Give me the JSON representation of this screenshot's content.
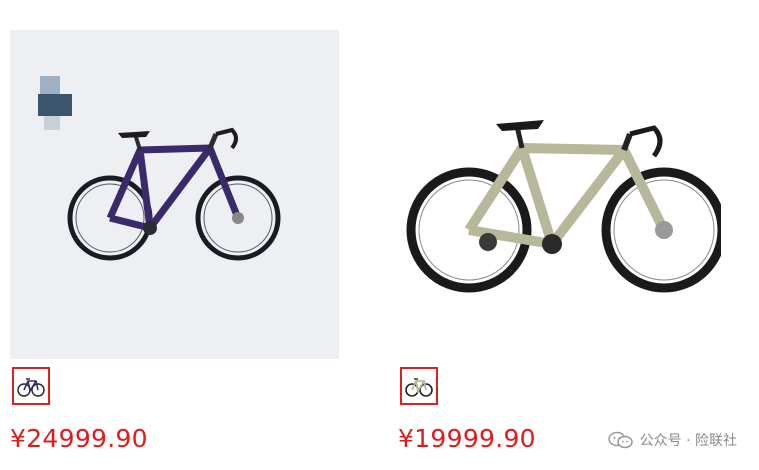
{
  "products": [
    {
      "price": "¥24999.90",
      "image": "purple-road-bike",
      "frame_color": "#3a2a6b",
      "background_color": "#eeeff2"
    },
    {
      "price": "¥19999.90",
      "image": "sage-gravel-bike",
      "frame_color": "#b7b89a",
      "background_color": "#ffffff"
    }
  ],
  "watermark": {
    "icon": "wechat-icon",
    "text": "公众号 · 险联社"
  },
  "colors": {
    "price": "#e01b1b",
    "thumb_border": "#e02020"
  }
}
